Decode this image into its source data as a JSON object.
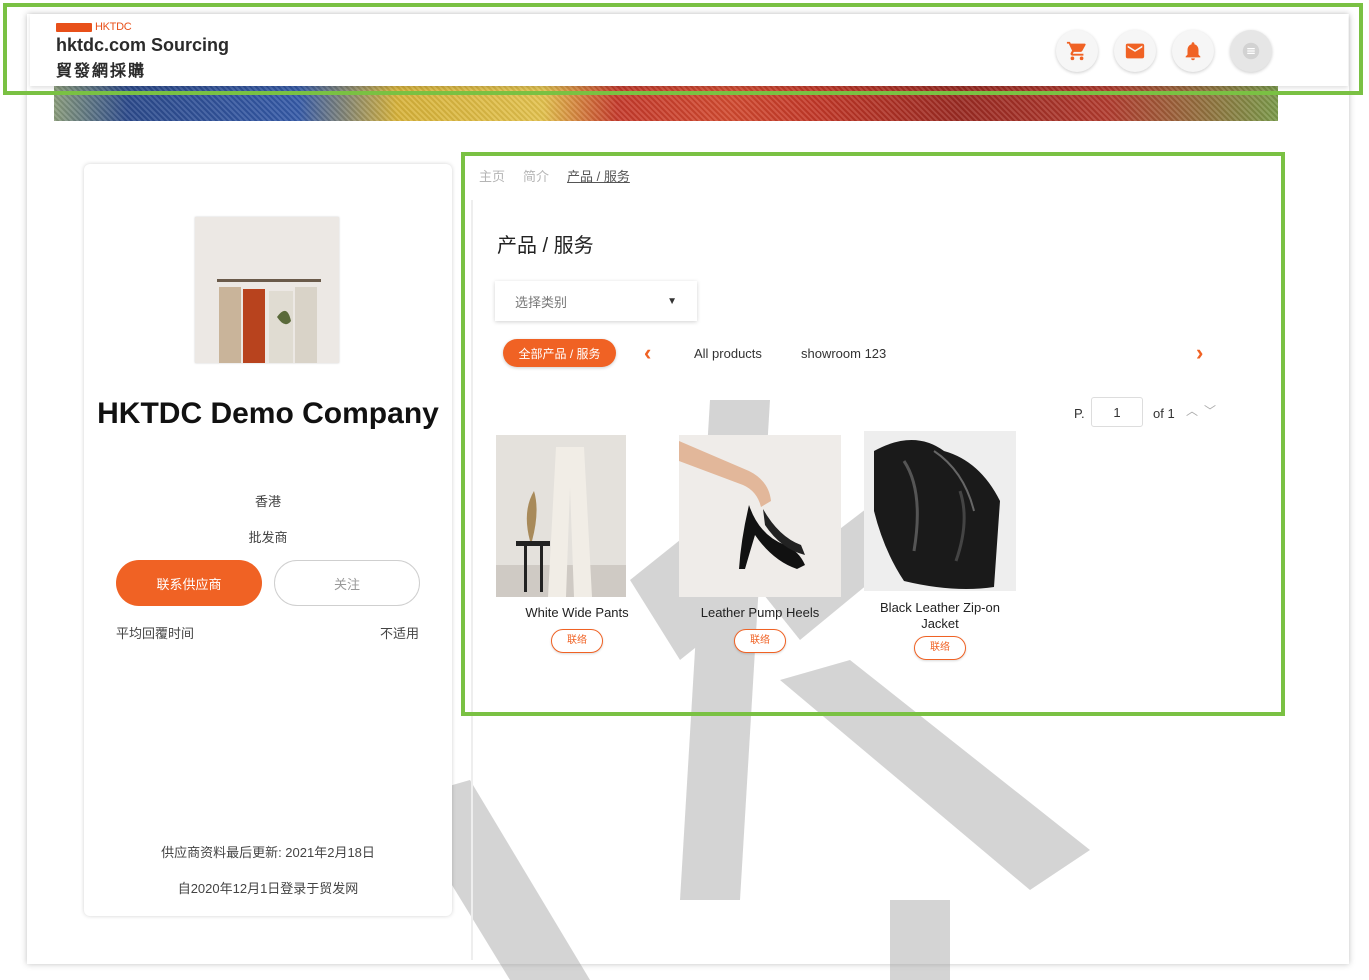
{
  "header": {
    "logo_small": "HKTDC",
    "logo_line1": "hktdc.com Sourcing",
    "logo_line2": "貿發網採購",
    "icons": [
      "cart-icon",
      "mail-icon",
      "bell-icon",
      "menu-icon"
    ]
  },
  "company": {
    "name": "HKTDC Demo Company",
    "location": "香港",
    "type": "批发商",
    "contact_label": "联系供应商",
    "follow_label": "关注",
    "response_label": "平均回覆时间",
    "response_value": "不适用",
    "updated_text": "供应商资料最后更新: 2021年2月18日",
    "joined_text": "自2020年12月1日登录于贸发网"
  },
  "breadcrumb": [
    "主页",
    "简介",
    "产品 / 服务"
  ],
  "products_section": {
    "title": "产品 / 服务",
    "category_placeholder": "选择类别",
    "active_chip": "全部产品 / 服务",
    "tabs": [
      "All products",
      "showroom 123"
    ],
    "pager": {
      "prefix": "P.",
      "page": "1",
      "of_text": "of 1"
    }
  },
  "products": [
    {
      "name": "White Wide Pants",
      "tag": "联络"
    },
    {
      "name": "Leather Pump Heels",
      "tag": "联络"
    },
    {
      "name": "Black Leather Zip-on Jacket",
      "tag": "联络"
    }
  ],
  "colors": {
    "accent": "#f06224",
    "highlight": "#7ac143"
  }
}
